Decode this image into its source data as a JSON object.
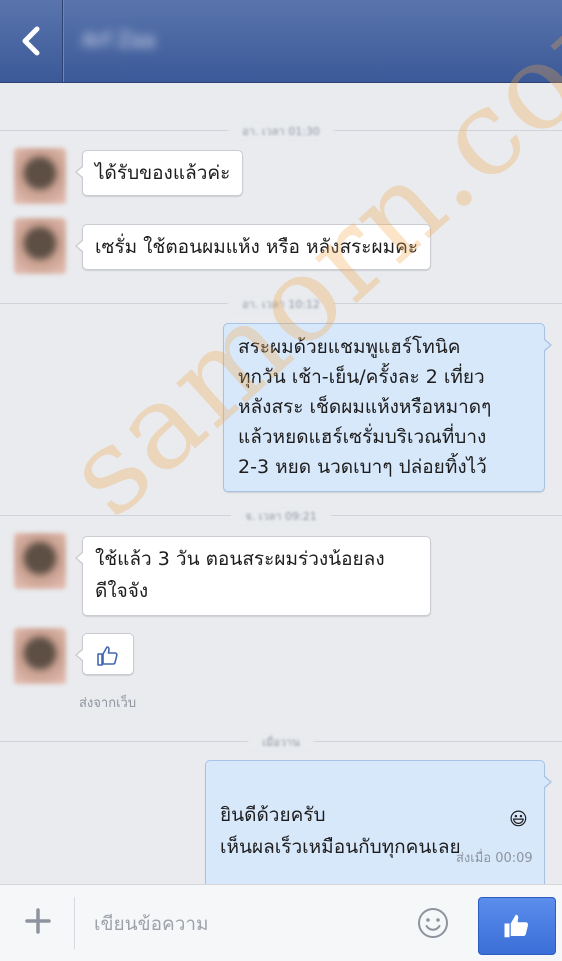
{
  "header": {
    "contact_name": "Arf Zaa"
  },
  "timeline": {
    "sep1": "อา. เวลา 01:30",
    "sep2": "อา. เวลา 10:12",
    "sep3": "จ. เวลา 09:21",
    "sep4": "เมื่อวาน"
  },
  "messages": {
    "m1": "ได้รับของแล้วค่ะ",
    "m2": "เซรั่ม ใช้ตอนผมแห้ง หรือ หลังสระผมคะ",
    "m3": "สระผมด้วยแชมพูแฮร์โทนิค\nทุกวัน เช้า-เย็น/ครั้งละ 2 เที่ยว\nหลังสระ เช็ดผมแห้งหรือหมาดๆ\nแล้วหยดแฮร์เซรั่มบริเวณที่บาง\n2-3 หยด นวดเบาๆ ปล่อยทิ้งไว้",
    "m4": "ใช้แล้ว 3 วัน ตอนสระผมร่วงน้อยลง\nดีใจจัง",
    "m5_icon": "thumbs-up-icon",
    "m5_meta": "ส่งจากเว็บ",
    "m6": "ยินดีด้วยครับ\nเห็นผลเร็วเหมือนกับทุกคนเลย",
    "m6_emoji": "😃",
    "m6_meta": "ส่งเมื่อ 00:09"
  },
  "watermark": "samorn.com",
  "composer": {
    "placeholder": "เขียนข้อความ"
  },
  "colors": {
    "header": "#3b5998",
    "outgoing_bubble": "#d8e8fb",
    "send_button": "#4a7fe3"
  }
}
